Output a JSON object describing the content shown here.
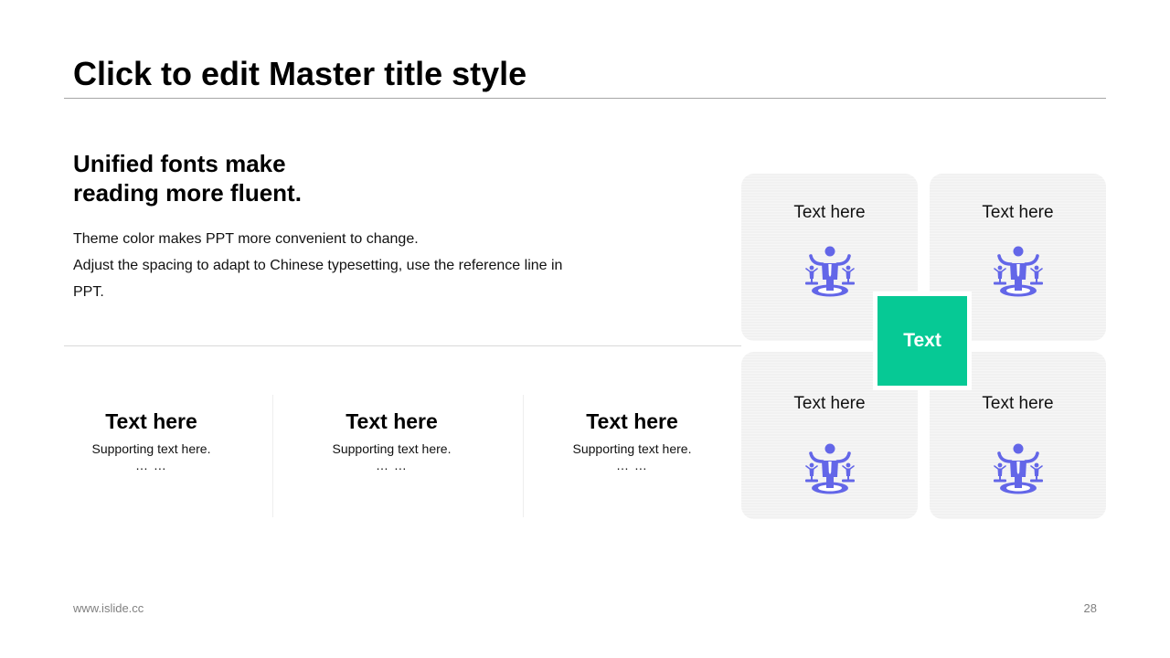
{
  "slide": {
    "title": "Click to edit Master title style",
    "heading": [
      "Unified fonts make",
      "reading more fluent."
    ],
    "body": [
      "Theme color makes PPT more convenient to change.",
      "Adjust the spacing to adapt to Chinese typesetting, use the reference line in PPT."
    ]
  },
  "columns": [
    {
      "title": "Text here",
      "subtitle": "Supporting  text here.",
      "dots": "… …"
    },
    {
      "title": "Text here",
      "subtitle": "Supporting  text here.",
      "dots": "… …"
    },
    {
      "title": "Text here",
      "subtitle": "Supporting  text here.",
      "dots": "… …"
    }
  ],
  "cards": [
    {
      "label": "Text here",
      "icon": "balance-person-icon"
    },
    {
      "label": "Text here",
      "icon": "balance-person-icon"
    },
    {
      "label": "Text here",
      "icon": "balance-person-icon"
    },
    {
      "label": "Text here",
      "icon": "balance-person-icon"
    }
  ],
  "center_label": "Text",
  "footer": {
    "url": "www.islide.cc",
    "page": "28"
  },
  "colors": {
    "accent": "#06c995",
    "icon": "#6366e8",
    "card_bg": "#f1f1f1"
  }
}
